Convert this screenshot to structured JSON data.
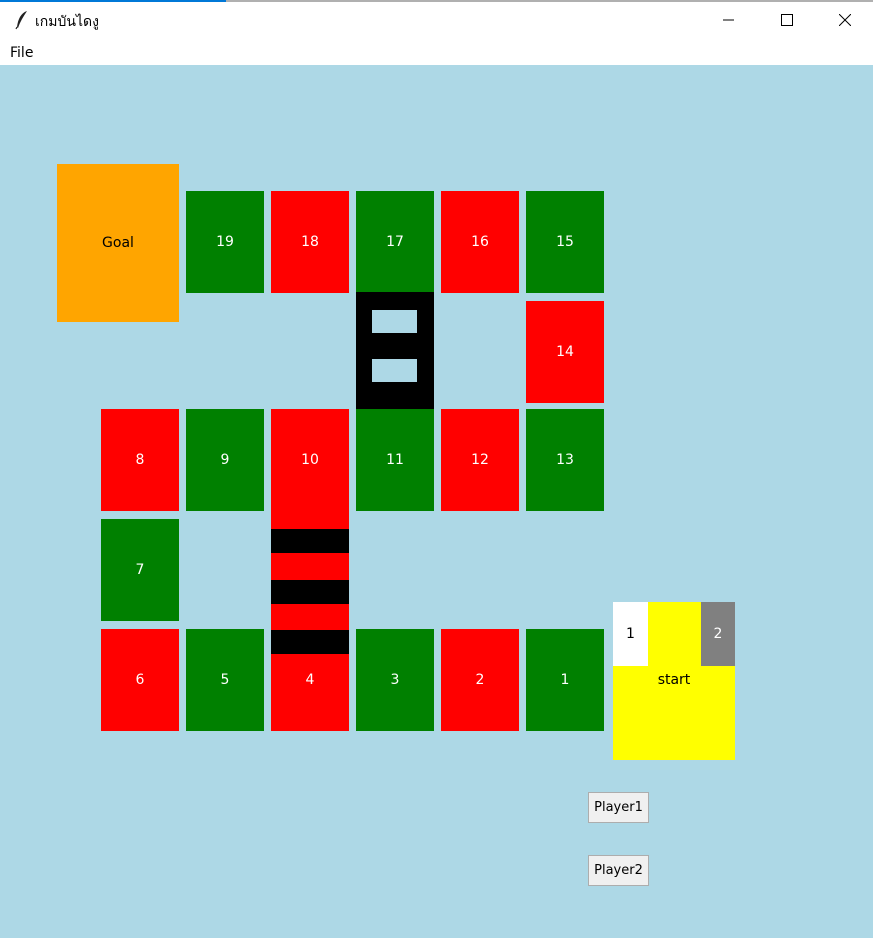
{
  "window": {
    "title": "เกมบันไดงู",
    "icon": "feather-icon"
  },
  "menu": {
    "file_label": "File"
  },
  "board": {
    "goal_label": "Goal",
    "start_label": "start",
    "tiles": [
      "1",
      "2",
      "3",
      "4",
      "5",
      "6",
      "7",
      "8",
      "9",
      "10",
      "11",
      "12",
      "13",
      "14",
      "15",
      "16",
      "17",
      "18",
      "19"
    ],
    "colors": {
      "red": "#ff0000",
      "green": "#008000",
      "goal": "#ffa500",
      "start": "#ffff00",
      "background": "#add8e6",
      "ladder": "#000000"
    },
    "player_markers": {
      "p1": "1",
      "p2": "2"
    }
  },
  "buttons": {
    "player1": "Player1",
    "player2": "Player2"
  }
}
